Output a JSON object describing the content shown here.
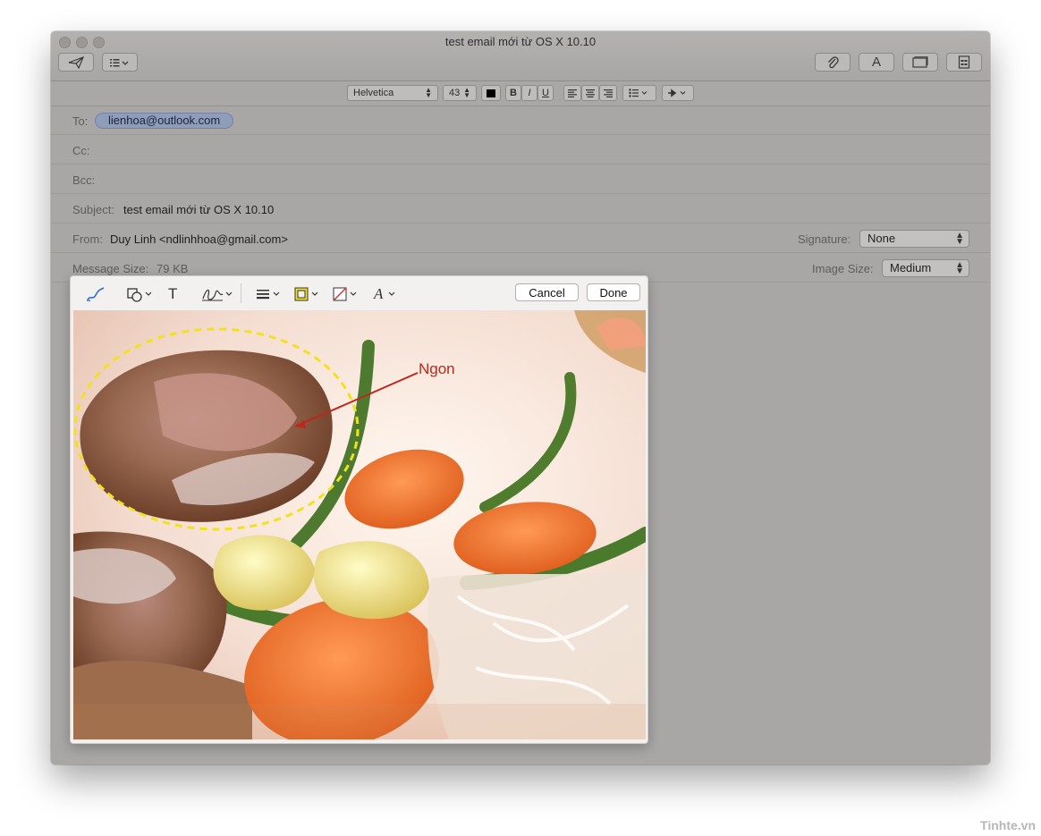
{
  "window": {
    "title": "test email mới từ OS X 10.10"
  },
  "toolbar": {
    "send_icon": "paper-plane-icon",
    "header_fields_icon": "list-chevron-icon",
    "attach_icon": "paperclip-icon",
    "fonts_label": "A",
    "photo_browser_icon": "photo-browser-icon",
    "stationery_icon": "stationery-icon"
  },
  "format": {
    "font": "Helvetica",
    "size": "43",
    "bold": "B",
    "italic": "I",
    "underline": "U"
  },
  "headers": {
    "to_label": "To:",
    "to_value": "lienhoa@outlook.com",
    "cc_label": "Cc:",
    "bcc_label": "Bcc:",
    "subject_label": "Subject:",
    "subject_value": "test email mới từ OS X 10.10",
    "from_label": "From:",
    "from_value": "Duy Linh <ndlinhhoa@gmail.com>",
    "signature_label": "Signature:",
    "signature_value": "None",
    "message_size_label": "Message Size:",
    "message_size_value": "79 KB",
    "image_size_label": "Image Size:",
    "image_size_value": "Medium"
  },
  "markup": {
    "cancel": "Cancel",
    "done": "Done",
    "text_tool": "T",
    "font_tool": "A",
    "annotation": "Ngon"
  },
  "watermark": "Tinhte.vn",
  "colors": {
    "accent": "#2d6fd6",
    "annotation": "#c0261a",
    "dashed_shape": "#f2e21e"
  }
}
